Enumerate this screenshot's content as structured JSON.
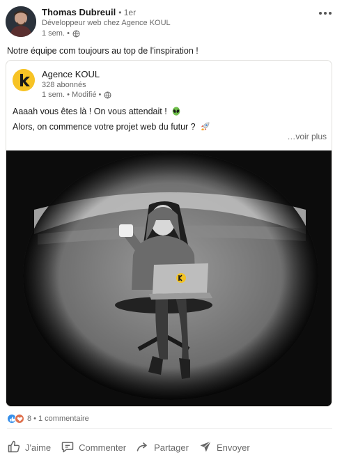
{
  "colors": {
    "like_blue": "#378fe9",
    "love_red": "#df704d",
    "koul_yellow": "#f7c325"
  },
  "post": {
    "author": {
      "name": "Thomas Dubreuil",
      "degree": "• 1er",
      "headline": "Développeur web chez Agence KOUL",
      "time": "1 sem. •",
      "visibility_icon": "globe-icon"
    },
    "more_icon": "more-horizontal-icon",
    "text": "Notre équipe com toujours au top de l'inspiration !"
  },
  "shared": {
    "company": {
      "name": "Agence KOUL",
      "followers": "328 abonnés",
      "meta": "1 sem. • Modifié •",
      "logo_letter": "k"
    },
    "text_line1": "Aaaah vous êtes là ! On vous attendait !",
    "text_line2": "Alors, on commence votre projet web du futur ?",
    "see_more": "…voir plus",
    "media_logo_letter": "k"
  },
  "social": {
    "reactions_count": "8",
    "separator": "•",
    "comments": "1 commentaire",
    "icons": [
      "like-icon",
      "love-icon"
    ]
  },
  "actions": [
    {
      "label": "J'aime",
      "icon": "thumbs-up-icon"
    },
    {
      "label": "Commenter",
      "icon": "comment-icon"
    },
    {
      "label": "Partager",
      "icon": "share-icon"
    },
    {
      "label": "Envoyer",
      "icon": "send-icon"
    }
  ]
}
